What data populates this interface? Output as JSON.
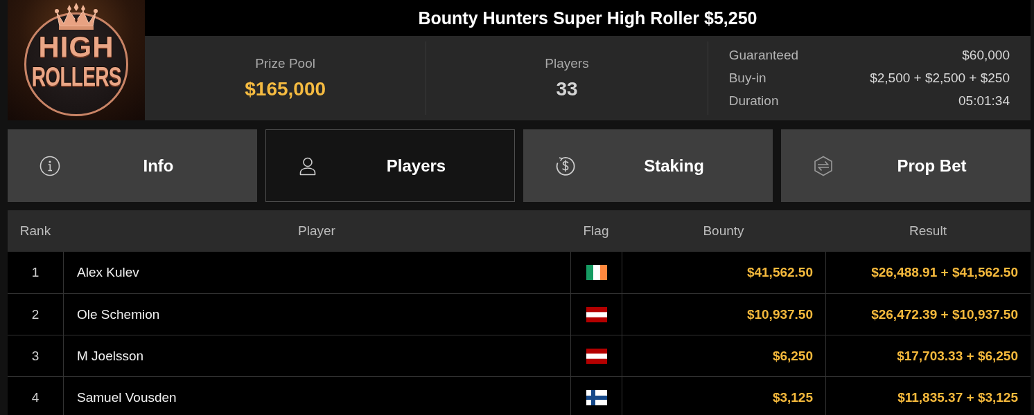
{
  "logo": {
    "lines": [
      "HIGH",
      "ROLLERS"
    ]
  },
  "title": "Bounty Hunters Super High Roller $5,250",
  "stats": [
    {
      "label": "Prize Pool",
      "value": "$165,000",
      "kind": "money"
    },
    {
      "label": "Players",
      "value": "33",
      "kind": "count"
    }
  ],
  "details": [
    {
      "label": "Guaranteed",
      "value": "$60,000"
    },
    {
      "label": "Buy-in",
      "value": "$2,500 + $2,500 + $250"
    },
    {
      "label": "Duration",
      "value": "05:01:34"
    }
  ],
  "tabs": [
    {
      "label": "Info",
      "selected": false
    },
    {
      "label": "Players",
      "selected": true
    },
    {
      "label": "Staking",
      "selected": false
    },
    {
      "label": "Prop Bet",
      "selected": false
    }
  ],
  "table": {
    "columns": [
      "Rank",
      "Player",
      "Flag",
      "Bounty",
      "Result"
    ],
    "rows": [
      {
        "rank": "1",
        "player": "Alex Kulev",
        "flag": {
          "kind": "ireland"
        },
        "bounty": "$41,562.50",
        "result": "$26,488.91 + $41,562.50"
      },
      {
        "rank": "2",
        "player": "Ole Schemion",
        "flag": {
          "kind": "austria"
        },
        "bounty": "$10,937.50",
        "result": "$26,472.39 + $10,937.50"
      },
      {
        "rank": "3",
        "player": "M Joelsson",
        "flag": {
          "kind": "austria"
        },
        "bounty": "$6,250",
        "result": "$17,703.33 + $6,250"
      },
      {
        "rank": "4",
        "player": "Samuel Vousden",
        "flag": {
          "kind": "finland"
        },
        "bounty": "$3,125",
        "result": "$11,835.37 + $3,125"
      }
    ]
  }
}
